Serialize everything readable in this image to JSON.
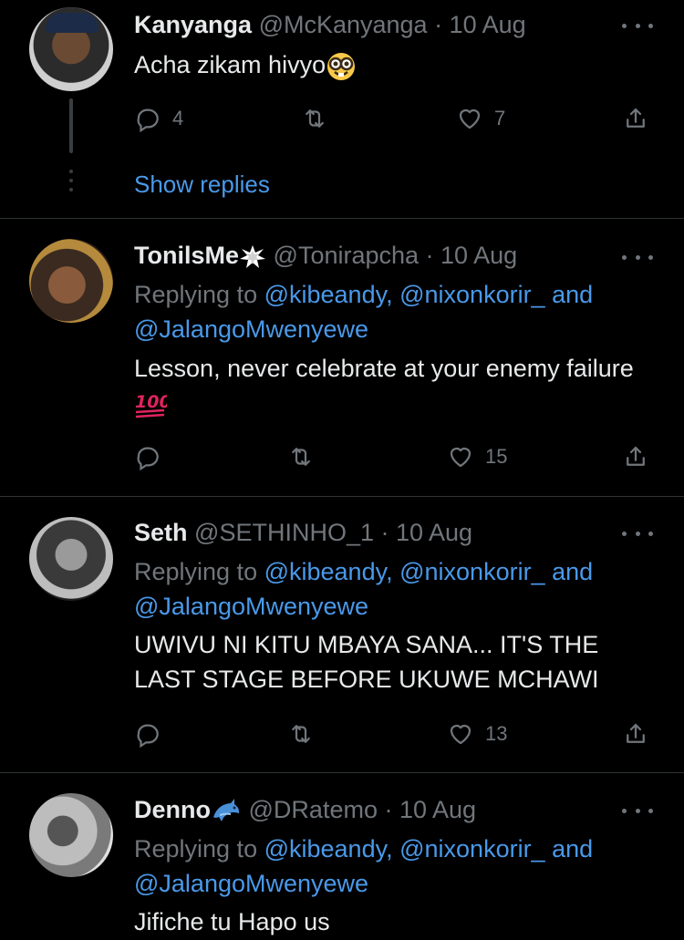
{
  "tweets": [
    {
      "name": "Kanyanga",
      "handle": "@McKanyanga · 10 Aug",
      "text": "Acha zikam hivyo",
      "replies": "4",
      "retweets": "",
      "likes": "7",
      "show_replies": "Show replies"
    },
    {
      "name": "TonilsMe",
      "handle": "@Tonirapcha · 10 Aug",
      "replying_prefix": "Replying to ",
      "mention1": "@kibeandy,",
      "mention2": "@nixonkorir_",
      "and": "and",
      "mention3": "@JalangoMwenyewe",
      "text": "Lesson, never celebrate at your enemy failure",
      "replies": "",
      "retweets": "",
      "likes": "15"
    },
    {
      "name": "Seth",
      "handle": "@SETHINHO_1 · 10 Aug",
      "replying_prefix": "Replying to ",
      "mention1": "@kibeandy,",
      "mention2": "@nixonkorir_",
      "and": "and",
      "mention3": "@JalangoMwenyewe",
      "text_line1": "UWIVU NI KITU MBAYA SANA... IT'S THE",
      "text_line2": "LAST STAGE BEFORE UKUWE MCHAWI",
      "replies": "",
      "retweets": "",
      "likes": "13"
    },
    {
      "name": "Denno",
      "handle": "@DRatemo · 10 Aug",
      "replying_prefix": "Replying to ",
      "mention1": "@kibeandy,",
      "mention2": "@nixonkorir_",
      "and": "and",
      "mention3": "@JalangoMwenyewe",
      "text": "Jifiche tu Hapo us"
    }
  ],
  "colors": {
    "background": "#000000",
    "text": "#e7e9ea",
    "muted": "#71767b",
    "link": "#4a99e9",
    "divider": "#2f3336"
  },
  "icons": [
    "reply-icon",
    "retweet-icon",
    "like-icon",
    "share-icon",
    "more-icon",
    "nerd-face-emoji",
    "hundred-points-emoji",
    "collision-emoji",
    "dolphin-emoji"
  ]
}
